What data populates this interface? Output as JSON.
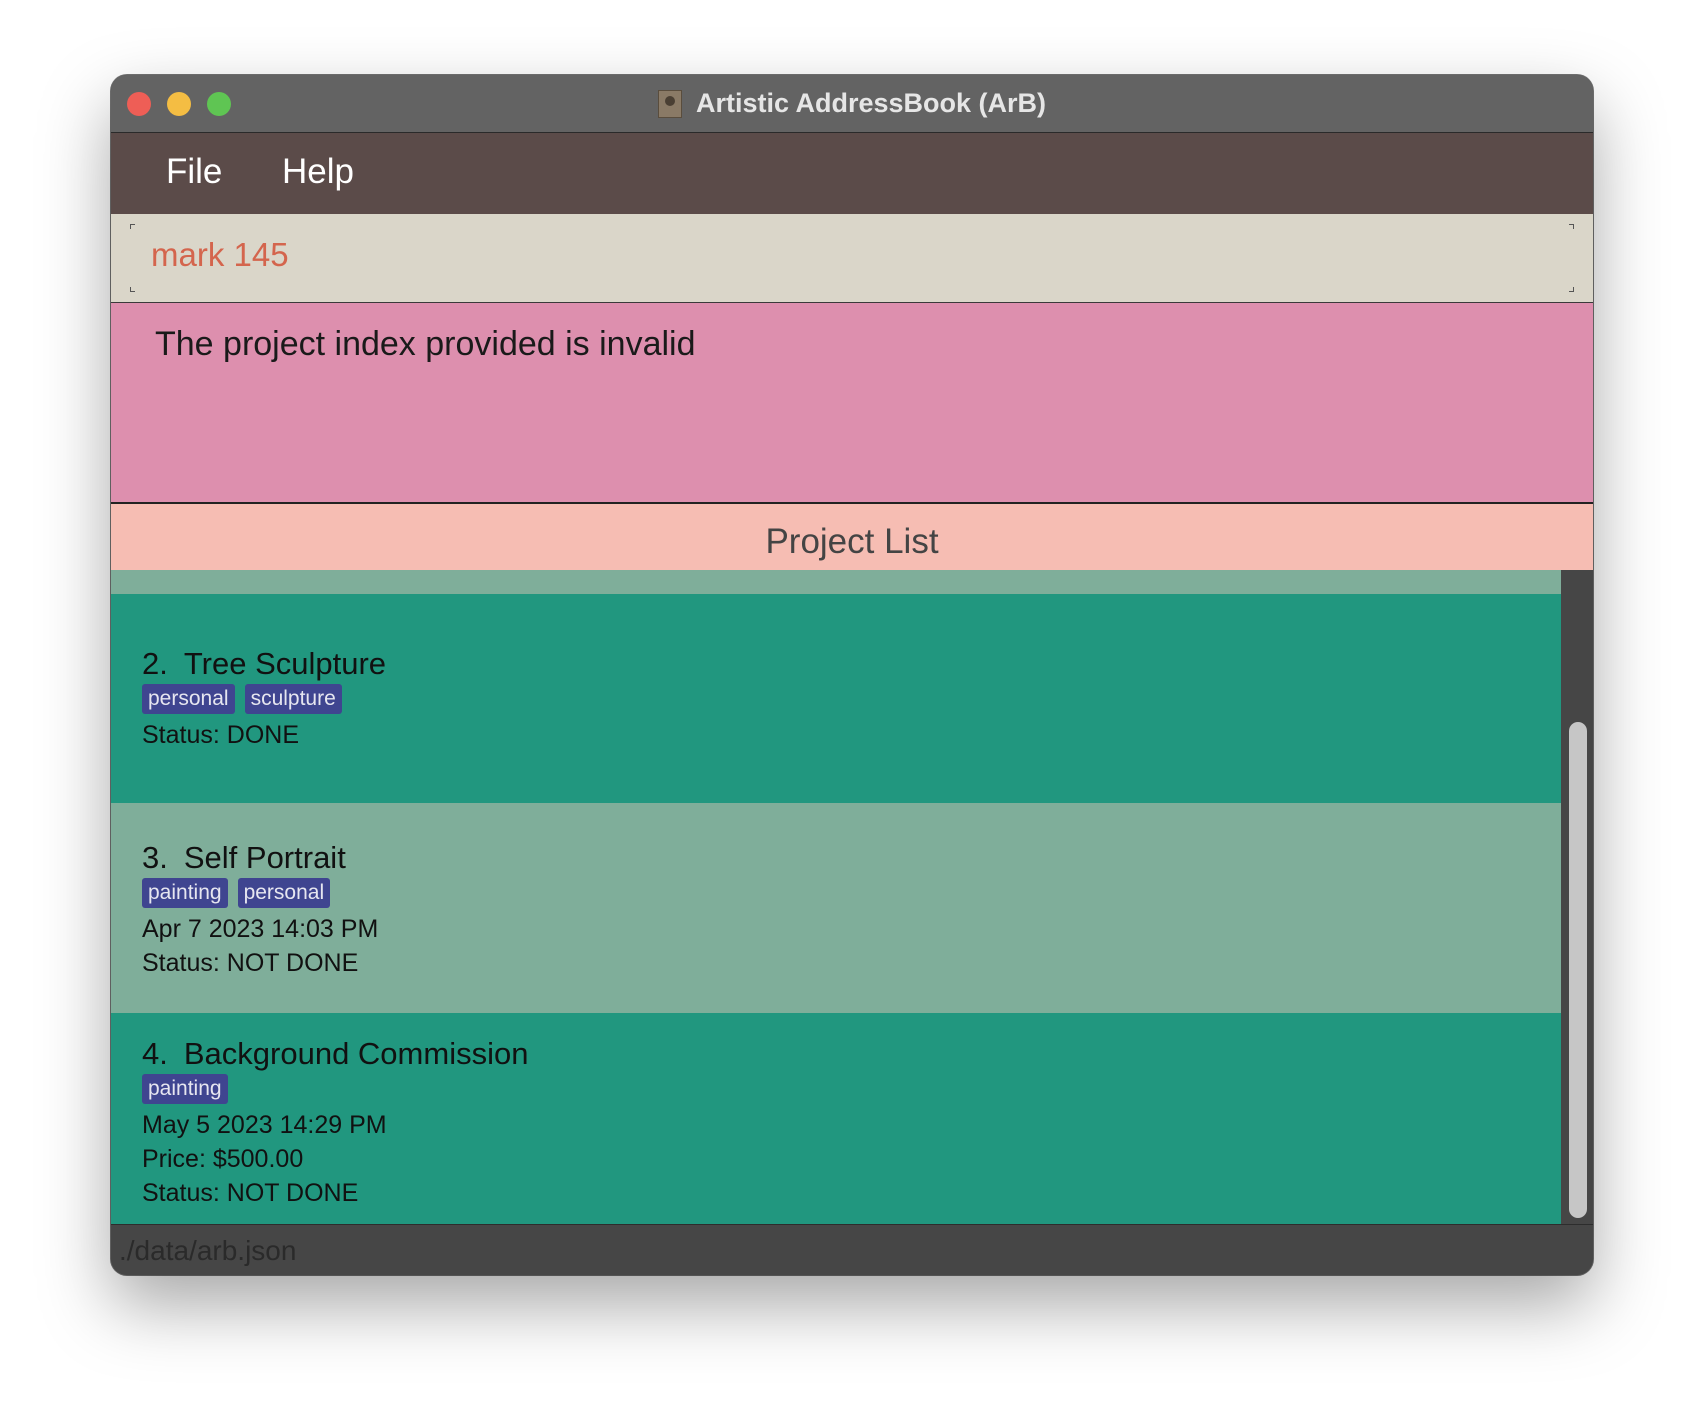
{
  "window": {
    "title": "Artistic AddressBook (ArB)"
  },
  "menu": {
    "file": "File",
    "help": "Help"
  },
  "command": {
    "value": "mark 145"
  },
  "result": {
    "message": "The project index provided is invalid"
  },
  "project_list": {
    "header": "Project List",
    "items": [
      {
        "index": "2.",
        "name": "Tree Sculpture",
        "tags": [
          "personal",
          "sculpture"
        ],
        "lines": [
          "Status: DONE"
        ]
      },
      {
        "index": "3.",
        "name": "Self Portrait",
        "tags": [
          "painting",
          "personal"
        ],
        "lines": [
          "Apr 7 2023 14:03 PM",
          "Status: NOT DONE"
        ]
      },
      {
        "index": "4.",
        "name": "Background Commission",
        "tags": [
          "painting"
        ],
        "lines": [
          "May 5 2023 14:29 PM",
          "Price: $500.00",
          "Status: NOT DONE"
        ]
      }
    ]
  },
  "status_bar": {
    "path": "./data/arb.json"
  },
  "colors": {
    "menubar": "#5b4b49",
    "command_bg": "#dad6c9",
    "command_text": "#d4654d",
    "result_bg": "#dd8fae",
    "list_header_bg": "#f6bdb3",
    "card_light": "#7fae9a",
    "card_dark": "#21977f",
    "tag_bg": "#3f4590"
  }
}
